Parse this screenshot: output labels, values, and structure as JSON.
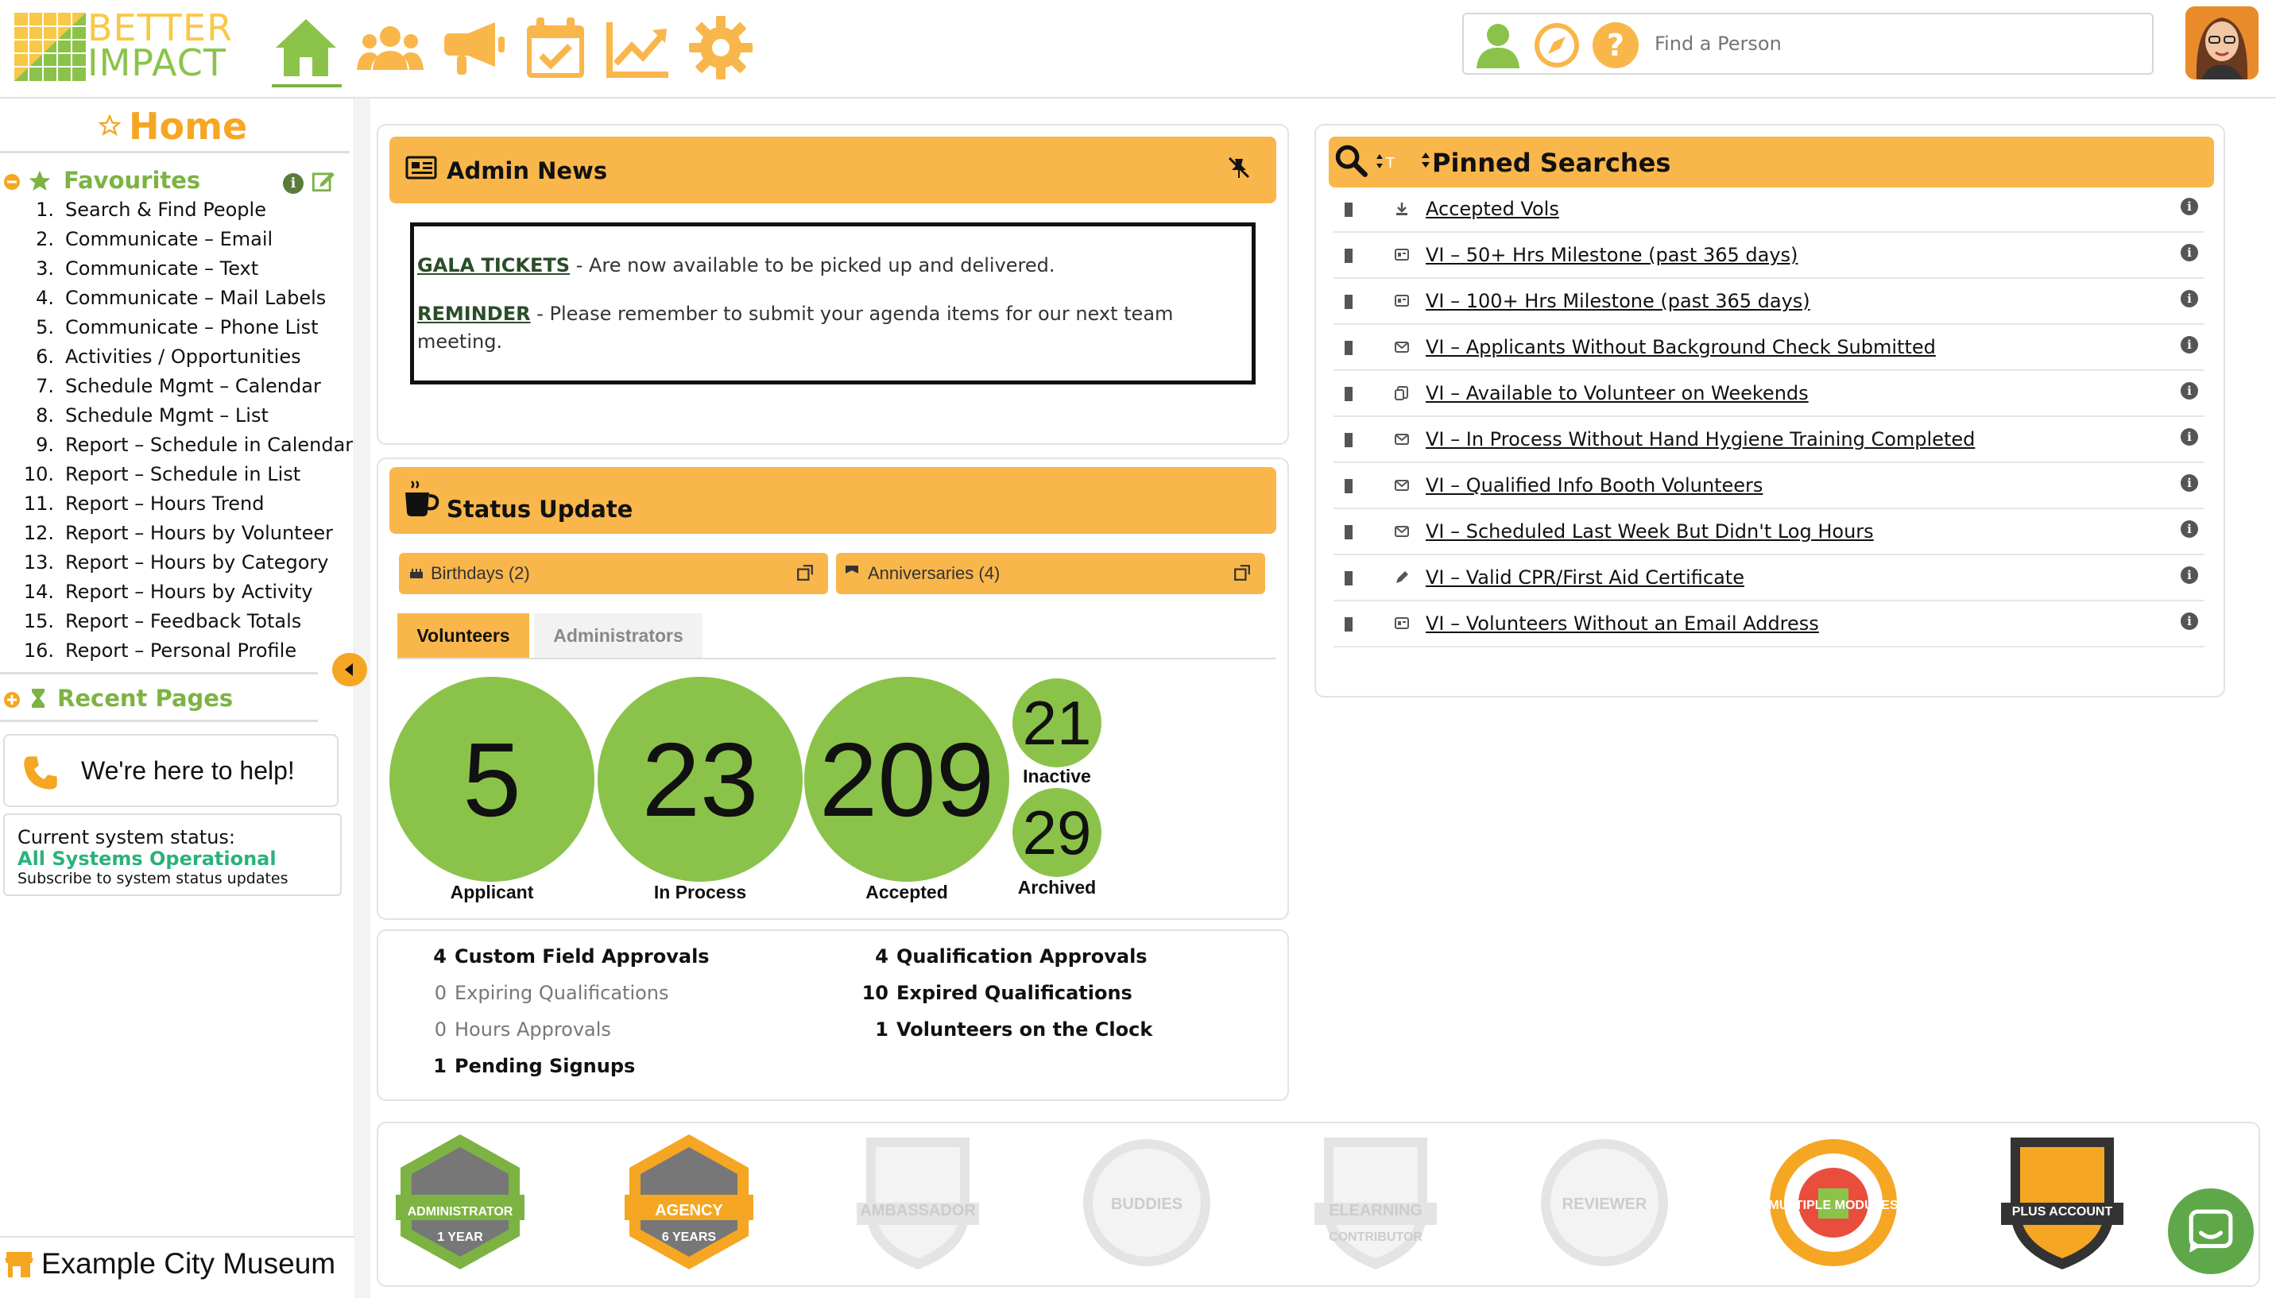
{
  "brand": {
    "logo_text_top": "BETTER",
    "logo_text_bottom": "IMPACT"
  },
  "nav": {
    "icons": [
      "home-icon",
      "people-icon",
      "megaphone-icon",
      "calendar-check-icon",
      "trend-chart-icon",
      "gear-icon"
    ],
    "active": "home"
  },
  "header": {
    "search": {
      "placeholder": "Find a Person",
      "value": ""
    },
    "icons": [
      "person-icon",
      "compass-icon",
      "help-icon"
    ]
  },
  "sidebar": {
    "page_title": "Home",
    "favourites_title": "Favourites",
    "favourites": [
      {
        "num": "1.",
        "label": "Search & Find People"
      },
      {
        "num": "2.",
        "label": "Communicate – Email"
      },
      {
        "num": "3.",
        "label": "Communicate – Text"
      },
      {
        "num": "4.",
        "label": "Communicate – Mail Labels"
      },
      {
        "num": "5.",
        "label": "Communicate – Phone List"
      },
      {
        "num": "6.",
        "label": "Activities / Opportunities"
      },
      {
        "num": "7.",
        "label": "Schedule Mgmt – Calendar"
      },
      {
        "num": "8.",
        "label": "Schedule Mgmt – List"
      },
      {
        "num": "9.",
        "label": "Report – Schedule in Calendar"
      },
      {
        "num": "10.",
        "label": "Report – Schedule in List"
      },
      {
        "num": "11.",
        "label": "Report – Hours Trend"
      },
      {
        "num": "12.",
        "label": "Report – Hours by Volunteer"
      },
      {
        "num": "13.",
        "label": "Report – Hours by Category"
      },
      {
        "num": "14.",
        "label": "Report – Hours by Activity"
      },
      {
        "num": "15.",
        "label": "Report – Feedback Totals"
      },
      {
        "num": "16.",
        "label": "Report – Personal Profile"
      }
    ],
    "recent_title": "Recent Pages",
    "help_text": "We're here to help!",
    "status": {
      "line1": "Current system status:",
      "line2": "All Systems Operational",
      "line3": "Subscribe to system status updates"
    },
    "org_name": "Example City Museum"
  },
  "admin_news": {
    "title": "Admin News",
    "items": [
      {
        "link": "GALA TICKETS",
        "text": " - Are now available to be picked up and delivered."
      },
      {
        "link": "REMINDER",
        "text": " - Please remember to submit your agenda items for our next team meeting."
      }
    ]
  },
  "status_update": {
    "title": "Status Update",
    "birthdays": "Birthdays (2)",
    "anniversaries": "Anniversaries (4)",
    "tabs": [
      "Volunteers",
      "Administrators"
    ],
    "active_tab": "Volunteers",
    "counts": [
      {
        "value": "5",
        "label": "Applicant"
      },
      {
        "value": "23",
        "label": "In Process"
      },
      {
        "value": "209",
        "label": "Accepted"
      },
      {
        "value": "21",
        "label": "Inactive"
      },
      {
        "value": "29",
        "label": "Archived"
      }
    ]
  },
  "approvals": {
    "left": [
      {
        "n": "4",
        "label": "Custom Field Approvals",
        "emphasis": true
      },
      {
        "n": "0",
        "label": "Expiring Qualifications",
        "emphasis": false
      },
      {
        "n": "0",
        "label": "Hours Approvals",
        "emphasis": false
      },
      {
        "n": "1",
        "label": "Pending Signups",
        "emphasis": true
      }
    ],
    "right": [
      {
        "n": "4",
        "label": "Qualification Approvals",
        "emphasis": true
      },
      {
        "n": "10",
        "label": "Expired Qualifications",
        "emphasis": true
      },
      {
        "n": "1",
        "label": "Volunteers on the Clock",
        "emphasis": true
      }
    ]
  },
  "pinned_searches": {
    "title": "Pinned Searches",
    "items": [
      {
        "label": "Accepted Vols",
        "icon": "download-icon"
      },
      {
        "label": "VI – 50+ Hrs Milestone (past 365 days)",
        "icon": "report-icon"
      },
      {
        "label": "VI – 100+ Hrs Milestone (past 365 days)",
        "icon": "report-icon"
      },
      {
        "label": "VI – Applicants Without Background Check Submitted",
        "icon": "mail-icon"
      },
      {
        "label": "VI – Available to Volunteer on Weekends",
        "icon": "copy-icon"
      },
      {
        "label": "VI – In Process Without Hand Hygiene Training Completed",
        "icon": "mail-icon"
      },
      {
        "label": "VI – Qualified Info Booth Volunteers",
        "icon": "mail-icon"
      },
      {
        "label": "VI – Scheduled Last Week But Didn't Log Hours",
        "icon": "mail-icon"
      },
      {
        "label": "VI – Valid CPR/First Aid Certificate",
        "icon": "pencil-icon"
      },
      {
        "label": "VI – Volunteers Without an Email Address",
        "icon": "report-icon"
      }
    ]
  },
  "badges": [
    {
      "line1": "ADMINISTRATOR",
      "line2": "1 YEAR",
      "earned": true,
      "color": "#7cb342"
    },
    {
      "line1": "AGENCY",
      "line2": "6 YEARS",
      "earned": true,
      "color": "#f5a623"
    },
    {
      "line1": "AMBASSADOR",
      "line2": "",
      "earned": false,
      "color": "#e0e0e0"
    },
    {
      "line1": "BUDDIES",
      "line2": "",
      "earned": false,
      "color": "#e0e0e0"
    },
    {
      "line1": "ELEARNING",
      "line2": "CONTRIBUTOR",
      "earned": false,
      "color": "#e0e0e0"
    },
    {
      "line1": "REVIEWER",
      "line2": "",
      "earned": false,
      "color": "#e0e0e0"
    },
    {
      "line1": "MULTIPLE MODULES",
      "line2": "",
      "earned": true,
      "color": "#f5a623"
    },
    {
      "line1": "PLUS ACCOUNT",
      "line2": "",
      "earned": true,
      "color": "#333333"
    }
  ],
  "colors": {
    "accent": "#f9b64b",
    "green": "#8bc34a",
    "brand_orange": "#f5a623",
    "brand_green": "#7cb342"
  }
}
